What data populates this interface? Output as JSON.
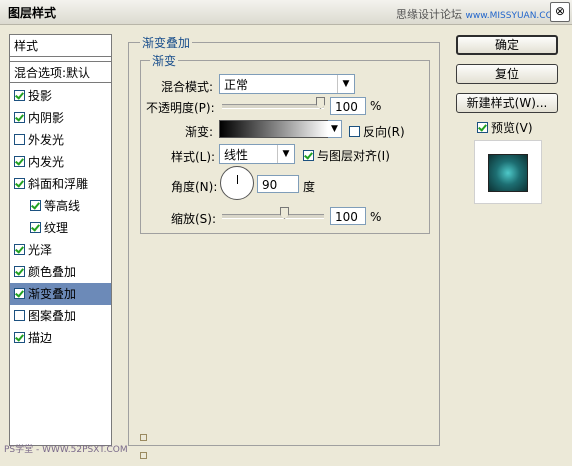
{
  "window": {
    "title": "图层样式",
    "watermark_text": "思缘设计论坛",
    "watermark_url": "www.MISSYUAN.COM",
    "close_label": "⊗"
  },
  "left_panel": {
    "header": "样式",
    "blend_options": "混合选项:默认",
    "items": [
      {
        "label": "投影",
        "checked": true
      },
      {
        "label": "内阴影",
        "checked": true
      },
      {
        "label": "外发光",
        "checked": false
      },
      {
        "label": "内发光",
        "checked": true
      },
      {
        "label": "斜面和浮雕",
        "checked": true
      },
      {
        "label": "等高线",
        "checked": true
      },
      {
        "label": "纹理",
        "checked": true
      },
      {
        "label": "光泽",
        "checked": true
      },
      {
        "label": "颜色叠加",
        "checked": true
      },
      {
        "label": "渐变叠加",
        "checked": true
      },
      {
        "label": "图案叠加",
        "checked": false
      },
      {
        "label": "描边",
        "checked": true
      }
    ]
  },
  "gradient_overlay": {
    "group_title": "渐变叠加",
    "subgroup_title": "渐变",
    "blend_mode_label": "混合模式:",
    "blend_mode_value": "正常",
    "opacity_label": "不透明度(P):",
    "opacity_value": "100",
    "opacity_unit": "%",
    "gradient_label": "渐变:",
    "reverse_label": "反向(R)",
    "reverse_checked": false,
    "style_label": "样式(L):",
    "style_value": "线性",
    "align_label": "与图层对齐(I)",
    "align_checked": true,
    "angle_label": "角度(N):",
    "angle_value": "90",
    "angle_unit": "度",
    "scale_label": "缩放(S):",
    "scale_value": "100",
    "scale_unit": "%"
  },
  "buttons": {
    "ok": "确定",
    "reset": "复位",
    "new_style": "新建样式(W)...",
    "preview_label": "预览(V)",
    "preview_checked": true
  },
  "footer": {
    "mark": "PS学堂 - WWW.52PSXT.COM"
  }
}
